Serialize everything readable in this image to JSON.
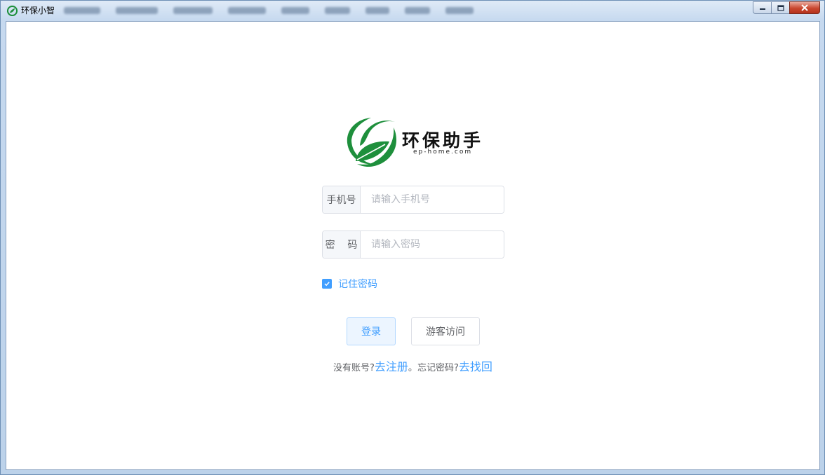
{
  "window": {
    "title": "环保小智"
  },
  "brand": {
    "name": "环保助手",
    "subtitle": "ep-home.com"
  },
  "login_form": {
    "phone": {
      "label": "手机号",
      "placeholder": "请输入手机号",
      "value": ""
    },
    "password": {
      "label": "密    码",
      "placeholder": "请输入密码",
      "value": ""
    },
    "remember": {
      "label": "记住密码",
      "checked": true
    },
    "buttons": {
      "login": "登录",
      "guest": "游客访问"
    },
    "links": {
      "no_account": "没有账号?",
      "register": "去注册",
      "separator": "。",
      "forgot": "忘记密码?",
      "recover": "去找回"
    }
  },
  "colors": {
    "accent": "#409eff",
    "logo_green": "#1e8f3c",
    "border": "#dcdfe6"
  }
}
